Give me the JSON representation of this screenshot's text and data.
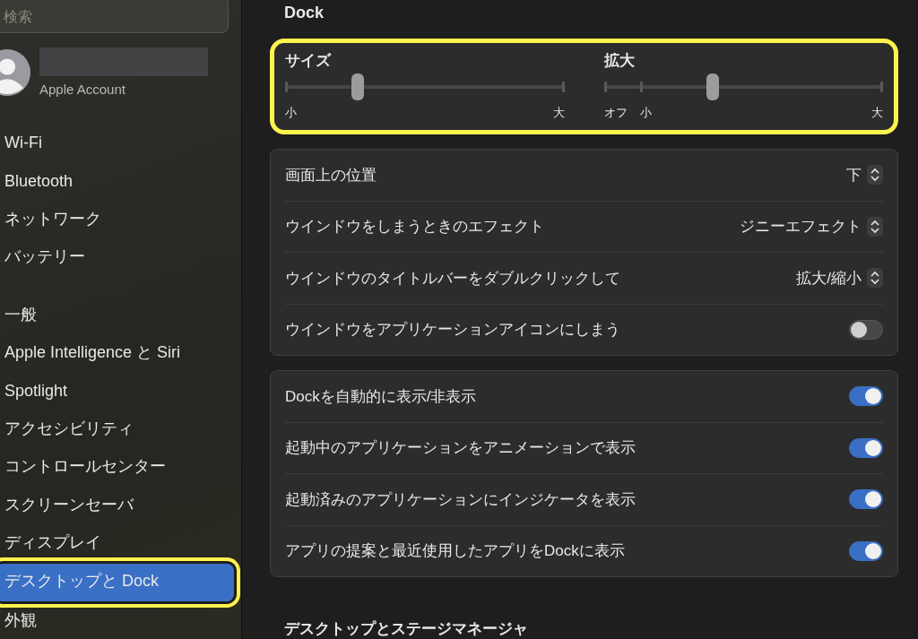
{
  "sidebar": {
    "search": {
      "placeholder": "検索"
    },
    "account": {
      "subtitle": "Apple Account"
    },
    "groups": [
      {
        "items": [
          {
            "label": "Wi-Fi",
            "selected": false,
            "highlighted": false
          },
          {
            "label": "Bluetooth",
            "selected": false,
            "highlighted": false
          },
          {
            "label": "ネットワーク",
            "selected": false,
            "highlighted": false
          },
          {
            "label": "バッテリー",
            "selected": false,
            "highlighted": false
          }
        ]
      },
      {
        "items": [
          {
            "label": "一般",
            "selected": false,
            "highlighted": false
          },
          {
            "label": "Apple Intelligence と Siri",
            "selected": false,
            "highlighted": false
          },
          {
            "label": "Spotlight",
            "selected": false,
            "highlighted": false
          },
          {
            "label": "アクセシビリティ",
            "selected": false,
            "highlighted": false
          },
          {
            "label": "コントロールセンター",
            "selected": false,
            "highlighted": false
          },
          {
            "label": "スクリーンセーバ",
            "selected": false,
            "highlighted": false
          },
          {
            "label": "ディスプレイ",
            "selected": false,
            "highlighted": false
          },
          {
            "label": "デスクトップと Dock",
            "selected": true,
            "highlighted": true
          },
          {
            "label": "外観",
            "selected": false,
            "highlighted": false
          }
        ]
      }
    ]
  },
  "content": {
    "title": "Dock",
    "slider_card": {
      "highlighted": true,
      "sliders": [
        {
          "label": "サイズ",
          "level": 0.26,
          "scale_labels": [
            "小",
            "大"
          ]
        },
        {
          "label": "拡大",
          "level": 0.39,
          "scale_labels": [
            "オフ",
            "小",
            "大"
          ]
        }
      ]
    },
    "groups": [
      {
        "rows": [
          {
            "kind": "popup",
            "label": "画面上の位置",
            "value": "下"
          },
          {
            "kind": "popup",
            "label": "ウインドウをしまうときのエフェクト",
            "value": "ジニーエフェクト"
          },
          {
            "kind": "popup",
            "label": "ウインドウのタイトルバーをダブルクリックして",
            "value": "拡大/縮小"
          },
          {
            "kind": "switch",
            "label": "ウインドウをアプリケーションアイコンにしまう",
            "on": false
          }
        ]
      },
      {
        "rows": [
          {
            "kind": "switch",
            "label": "Dockを自動的に表示/非表示",
            "on": true
          },
          {
            "kind": "switch",
            "label": "起動中のアプリケーションをアニメーションで表示",
            "on": true
          },
          {
            "kind": "switch",
            "label": "起動済みのアプリケーションにインジケータを表示",
            "on": true
          },
          {
            "kind": "switch",
            "label": "アプリの提案と最近使用したアプリをDockに表示",
            "on": true
          }
        ]
      }
    ],
    "next_section": "デスクトップとステージマネージャ"
  }
}
